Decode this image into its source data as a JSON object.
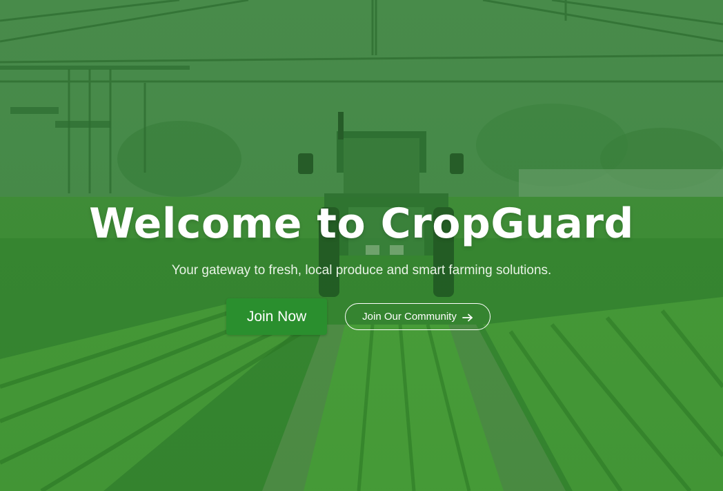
{
  "hero": {
    "title": "Welcome to CropGuard",
    "subtitle": "Your gateway to fresh, local produce and smart farming solutions.",
    "primary_button": "Join Now",
    "secondary_button": "Join Our Community",
    "secondary_icon": "arrow-right-icon",
    "background": "greenhouse-field-with-tractor",
    "colors": {
      "overlay": "#3f8240",
      "primary_button": "#2a8f2e",
      "text": "#ffffff"
    }
  }
}
